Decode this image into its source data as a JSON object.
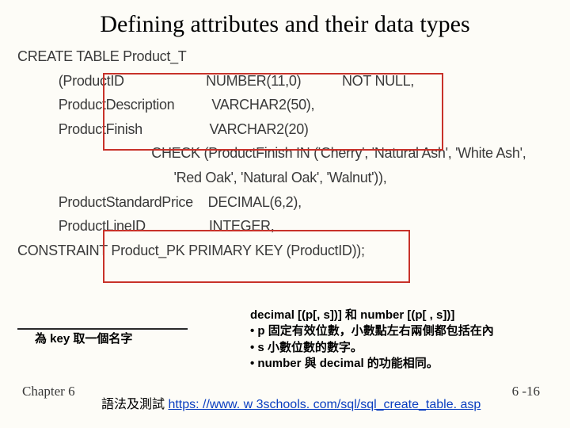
{
  "title": "Defining attributes and their data types",
  "code": {
    "line1": "CREATE TABLE Product_T",
    "col1_1": "(ProductID",
    "col2_1": "NUMBER(11,0)",
    "col3_1": "NOT NULL,",
    "col1_2": "ProductDescription",
    "col2_2": "VARCHAR2(50),",
    "col1_3": "ProductFinish",
    "col2_3": "VARCHAR2(20)",
    "check": "CHECK (ProductFinish IN ('Cherry', 'Natural Ash', 'White Ash',",
    "check2": "'Red Oak', 'Natural Oak', 'Walnut')),",
    "col1_4": "ProductStandardPrice",
    "col2_4": "DECIMAL(6,2),",
    "col1_5": "ProductLineID",
    "col2_5": "INTEGER,",
    "constraint": "CONSTRAINT Product_PK PRIMARY KEY (ProductID));"
  },
  "callout_left": "為 key 取一個名字",
  "callout_right": {
    "l1": "decimal [(p[, s])] 和 number [(p[ , s])]",
    "l2": "• p 固定有效位數，小數點左右兩側都包括在內",
    "l3": "• s 小數位數的數字。",
    "l4": "• number 與 decimal 的功能相同。"
  },
  "chapter": "Chapter 6",
  "footer_label": "語法及測試 ",
  "footer_url": "https: //www. w 3schools. com/sql/sql_create_table. asp",
  "pagenum": "6 -16"
}
